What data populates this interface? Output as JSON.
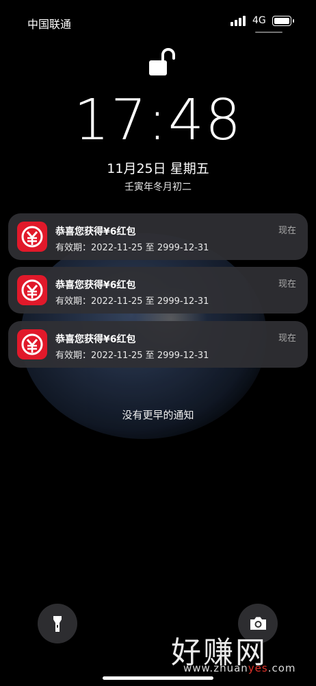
{
  "status_bar": {
    "carrier": "中国联通",
    "network": "4G"
  },
  "lock_screen": {
    "time": "17:48",
    "date": "11月25日 星期五",
    "lunar_date": "壬寅年冬月初二"
  },
  "notifications": [
    {
      "title": "恭喜您获得¥6红包",
      "body": "有效期：2022-11-25 至 2999-12-31",
      "time": "现在",
      "icon": "digital-rmb-app-icon"
    },
    {
      "title": "恭喜您获得¥6红包",
      "body": "有效期：2022-11-25 至 2999-12-31",
      "time": "现在",
      "icon": "digital-rmb-app-icon"
    },
    {
      "title": "恭喜您获得¥6红包",
      "body": "有效期：2022-11-25 至 2999-12-31",
      "time": "现在",
      "icon": "digital-rmb-app-icon"
    }
  ],
  "no_earlier_text": "没有更早的通知",
  "quick_actions": {
    "left_icon": "flashlight-icon",
    "right_icon": "camera-icon"
  },
  "watermark": {
    "main": "好赚网",
    "sub_prefix": "www.zhuan",
    "sub_accent": "yes",
    "sub_suffix": ".com"
  },
  "colors": {
    "app_icon_red": "#e1192a",
    "watermark_accent": "#e0332a"
  }
}
